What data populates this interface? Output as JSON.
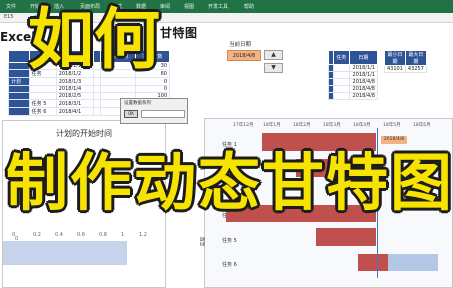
{
  "ribbon": {
    "tabs": [
      "文件",
      "开始",
      "插入",
      "页面布局",
      "公式",
      "数据",
      "审阅",
      "视图",
      "开发工具",
      "帮助"
    ]
  },
  "formula_bar": {
    "fx": "fx",
    "cell_ref": "E15"
  },
  "sheet": {
    "title_left": "Excel",
    "title_right": "甘特图"
  },
  "task_table": {
    "headers": [
      "",
      "任务",
      "开始日期",
      "",
      "结束日期",
      "完成天数"
    ],
    "rows": [
      {
        "cells": [
          "",
          "",
          "2018/1/1",
          "",
          "",
          "30"
        ]
      },
      {
        "cells": [
          "",
          "任务",
          "2018/1/2",
          "",
          "",
          "60"
        ]
      },
      {
        "cells": [
          "计划",
          "",
          "2018/1/3",
          "",
          "",
          "0"
        ]
      },
      {
        "cells": [
          "",
          "",
          "2018/1/4",
          "",
          "",
          "0"
        ]
      },
      {
        "cells": [
          "",
          "",
          "2018/2/5",
          "",
          "",
          "100"
        ]
      },
      {
        "cells": [
          "",
          "任务 5",
          "2018/3/1",
          "",
          "",
          "0"
        ]
      },
      {
        "cells": [
          "",
          "任务 6",
          "2018/4/1",
          "",
          "",
          "0"
        ]
      }
    ]
  },
  "date_selector": {
    "label": "当前日期",
    "value": "2018/4/8",
    "up": "▲",
    "down": "▼"
  },
  "stats_left": {
    "headers": [
      "",
      "任务",
      "日期"
    ],
    "rows": [
      [
        "",
        "",
        "2018/1/1"
      ],
      [
        "",
        "",
        "2018/1/1"
      ],
      [
        "",
        "",
        "2018/4/8"
      ],
      [
        "",
        "",
        "2018/4/8"
      ],
      [
        "",
        "",
        "2018/4/8"
      ]
    ]
  },
  "stats_right": {
    "headers": [
      "最小日期",
      "最大日期"
    ],
    "rows": [
      [
        "43101",
        "43257"
      ]
    ]
  },
  "dialog": {
    "title": "设置数据系列",
    "button": "OK"
  },
  "left_chart": {
    "title": "计划的开始时间",
    "axis_ticks": [
      "0",
      "0.2",
      "0.4",
      "0.6",
      "0.8",
      "1",
      "1.2"
    ]
  },
  "gantt": {
    "months": [
      "17年12月",
      "18年1月",
      "18年2月",
      "18年3月",
      "18年4月",
      "18年5月",
      "18年6月"
    ],
    "today_tag": "2018/4/8",
    "tasks": [
      "任务 1",
      "任务 2",
      "任务 4",
      "任务 5",
      "任务 6"
    ],
    "groups": [
      "计划",
      "实际"
    ]
  },
  "overlay": {
    "line1": "如何",
    "line2": "制作动态甘特图"
  },
  "colors": {
    "ribbon": "#217346",
    "header_blue": "#2f5496",
    "bar_red": "#c0504d",
    "bar_blue": "#b4c7e7",
    "highlight": "#f4b183",
    "overlay_yellow": "#f6e400"
  }
}
